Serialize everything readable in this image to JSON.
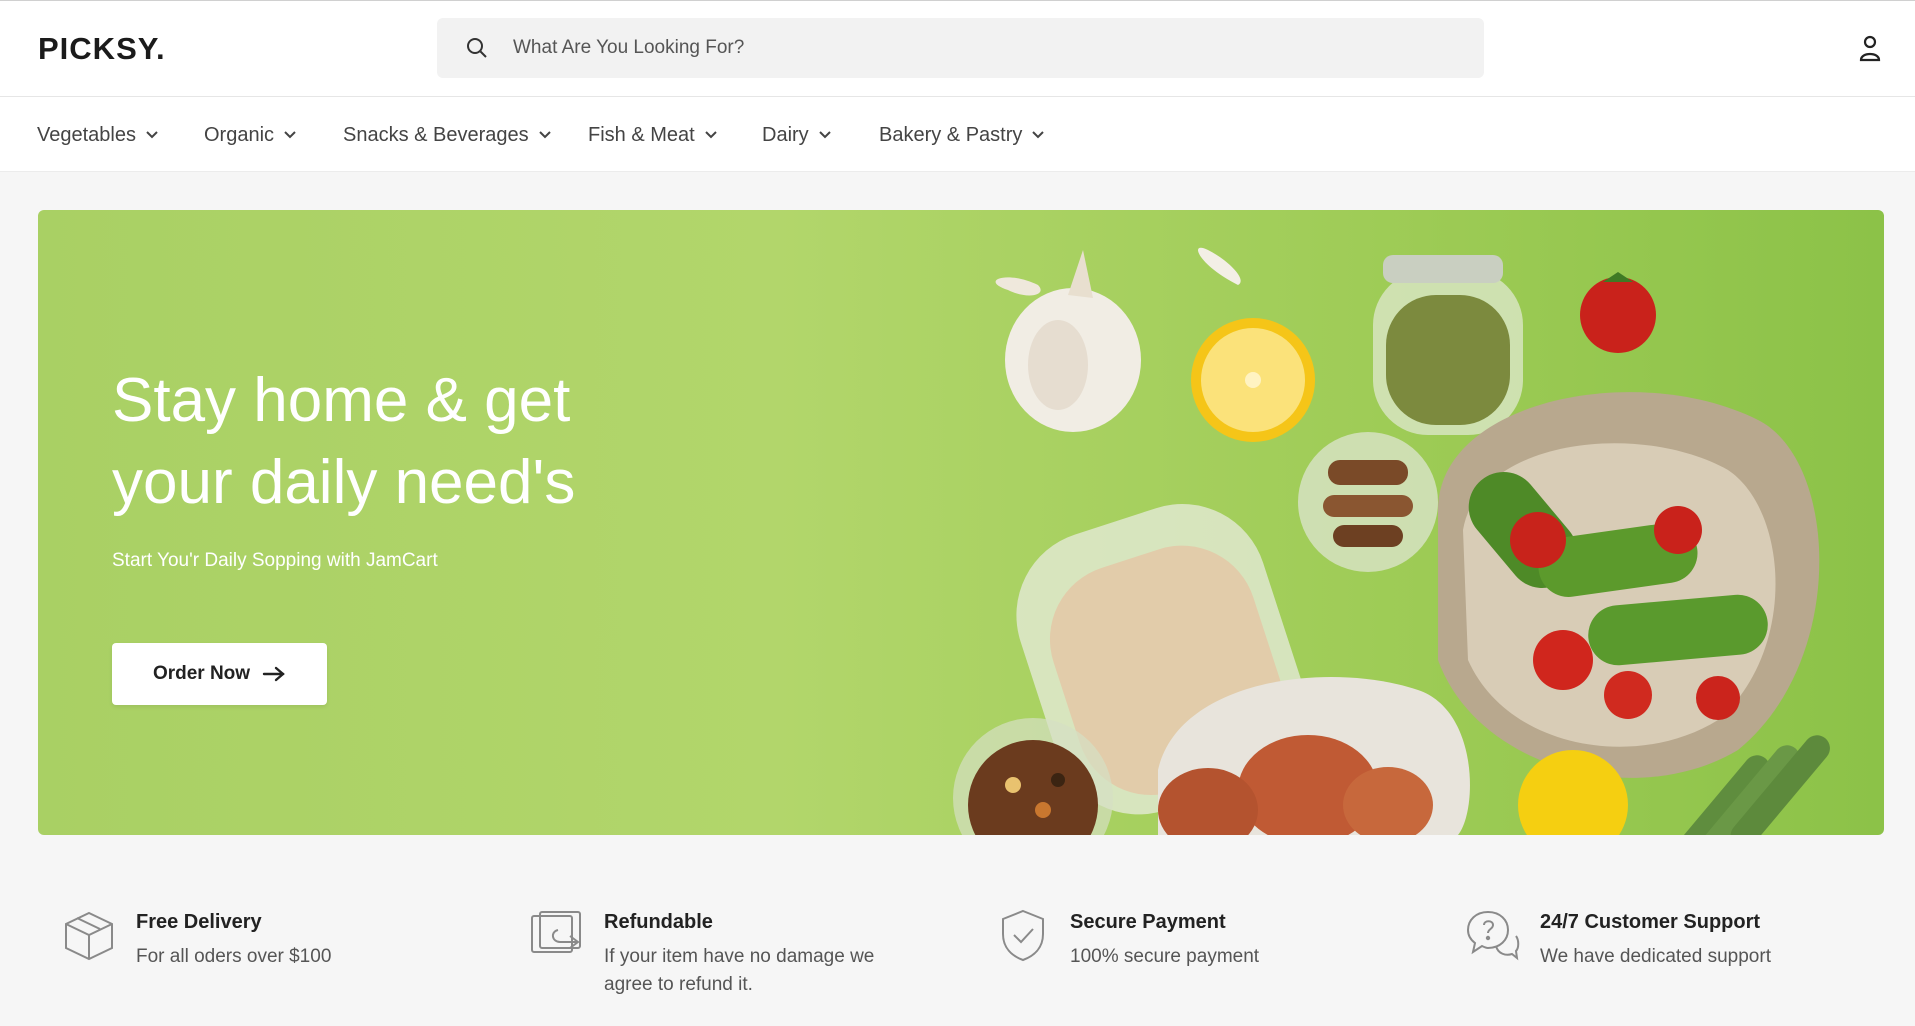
{
  "header": {
    "logo": "PICKSY.",
    "search_placeholder": "What Are You Looking For?",
    "icons": {
      "search": "search-icon",
      "user": "user-icon"
    }
  },
  "nav": {
    "items": [
      {
        "label": "Vegetables"
      },
      {
        "label": "Organic"
      },
      {
        "label": "Snacks & Beverages"
      },
      {
        "label": "Fish & Meat"
      },
      {
        "label": "Dairy"
      },
      {
        "label": "Bakery & Pastry"
      }
    ]
  },
  "hero": {
    "title_line1": "Stay home & get",
    "title_line2": "your daily need's",
    "subtitle": "Start You'r Daily Sopping with JamCart",
    "cta_label": "Order Now",
    "background": "#a9d064"
  },
  "features": [
    {
      "icon": "box-icon",
      "title": "Free Delivery",
      "desc": "For all oders over $100"
    },
    {
      "icon": "refund-icon",
      "title": "Refundable",
      "desc": "If your item have no damage we agree to refund it."
    },
    {
      "icon": "shield-check-icon",
      "title": "Secure Payment",
      "desc": "100% secure payment"
    },
    {
      "icon": "support-chat-icon",
      "title": "24/7 Customer Support",
      "desc": "We have dedicated support"
    }
  ]
}
